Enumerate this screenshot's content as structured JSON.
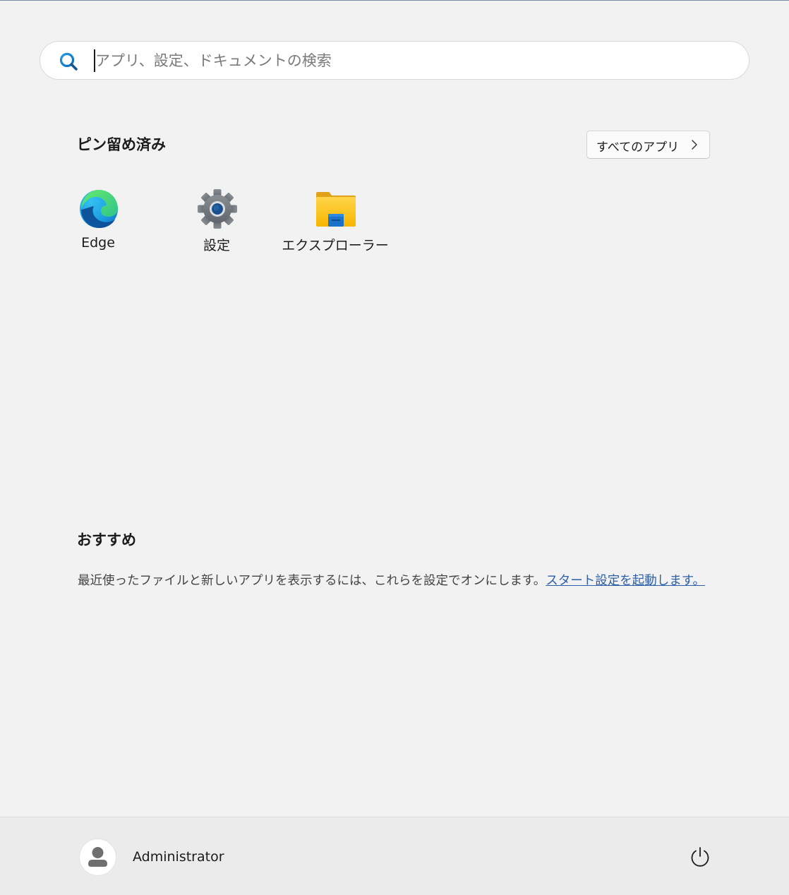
{
  "search": {
    "placeholder": "アプリ、設定、ドキュメントの検索",
    "value": "",
    "icon": "search-icon"
  },
  "pinned": {
    "title": "ピン留め済み",
    "all_apps_label": "すべてのアプリ",
    "apps": [
      {
        "label": "Edge",
        "icon": "edge-icon"
      },
      {
        "label": "設定",
        "icon": "settings-gear-icon"
      },
      {
        "label": "エクスプローラー",
        "icon": "file-explorer-folder-icon"
      }
    ]
  },
  "recommended": {
    "title": "おすすめ",
    "message": "最近使ったファイルと新しいアプリを表示するには、これらを設定でオンにします。",
    "link_text": "スタート設定を起動します。"
  },
  "footer": {
    "user_name": "Administrator",
    "user_icon": "user-avatar-icon",
    "power_icon": "power-icon"
  },
  "colors": {
    "background": "#f2f2f2",
    "footer_background": "#ebebeb",
    "link": "#2d5fa8",
    "search_accent": "#0078d4"
  }
}
